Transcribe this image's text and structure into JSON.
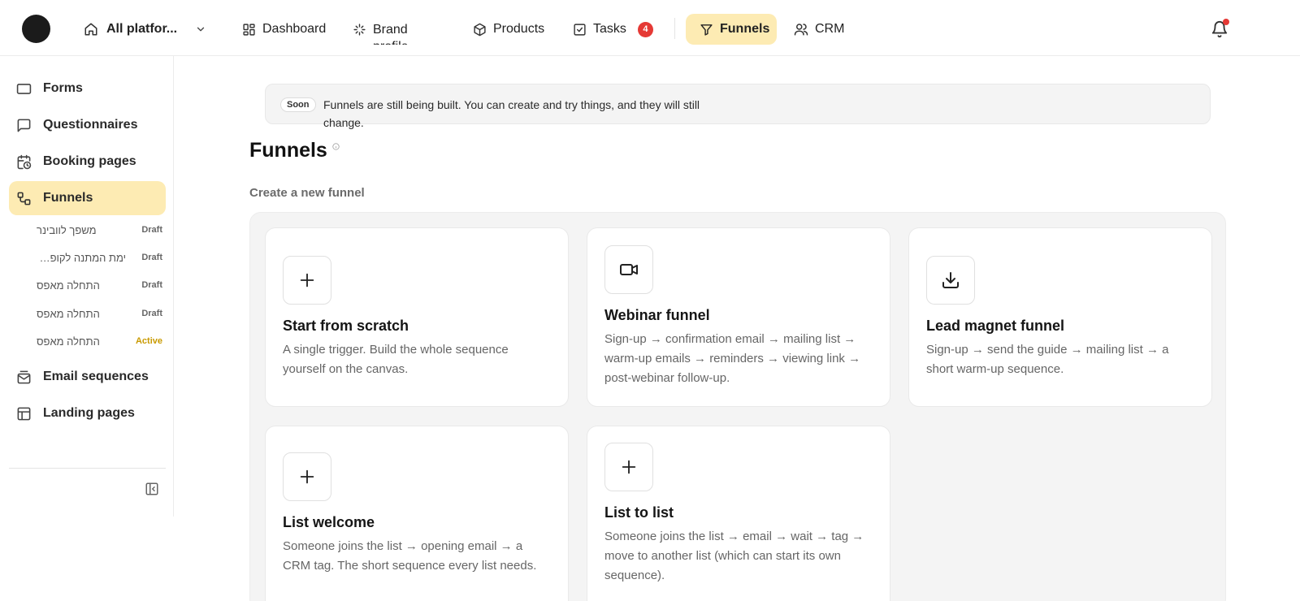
{
  "topbar": {
    "platform": "All platfor...",
    "nav": {
      "dashboard": "Dashboard",
      "brand_profile": "Brand profile",
      "products": "Products",
      "tasks": "Tasks",
      "tasks_badge": "4",
      "funnels": "Funnels",
      "crm": "CRM"
    }
  },
  "sidebar": {
    "items": {
      "forms": "Forms",
      "questionnaires": "Questionnaires",
      "booking": "Booking pages",
      "funnels": "Funnels",
      "email": "Email sequences",
      "landing": "Landing pages"
    },
    "funnels": [
      {
        "name": "משפך לוובינר",
        "status": "Draft"
      },
      {
        "name": "ימת המתנה לקופלו...",
        "status": "Draft"
      },
      {
        "name": "התחלה מאפס",
        "status": "Draft"
      },
      {
        "name": "התחלה מאפס",
        "status": "Draft"
      },
      {
        "name": "התחלה מאפס",
        "status": "Active"
      }
    ]
  },
  "notice": {
    "badge": "Soon",
    "text": "Funnels are still being built. You can create and try things, and they will still change."
  },
  "page": {
    "title": "Funnels",
    "section": "Create a new funnel"
  },
  "cards": [
    {
      "title": "Start from scratch",
      "desc": "A single trigger. Build the whole sequence yourself on the canvas."
    },
    {
      "title": "Webinar funnel",
      "desc": "Sign-up → confirmation email → mailing list → warm-up emails → reminders → viewing link → post-webinar follow-up."
    },
    {
      "title": "Lead magnet funnel",
      "desc": "Sign-up → send the guide → mailing list → a short warm-up sequence."
    },
    {
      "title": "List welcome",
      "desc": "Someone joins the list → opening email → a CRM tag. The short sequence every list needs."
    },
    {
      "title": "List to list",
      "desc": "Someone joins the list → email → wait → tag → move to another list (which can start its own sequence)."
    }
  ],
  "colors": {
    "active_bg": "#fdebb3",
    "badge_red": "#e53935",
    "active_status": "#c99a00"
  }
}
